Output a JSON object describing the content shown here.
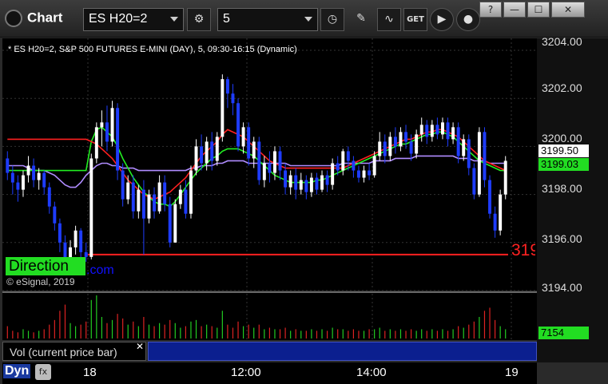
{
  "window": {
    "title": "Chart",
    "help_label": "?",
    "minimize_label": "—",
    "maximize_label": "☐",
    "close_label": "✕"
  },
  "toolbar": {
    "symbol": "ES H20=2",
    "interval": "5"
  },
  "chart": {
    "info_line": "* ES H20=2, S&P 500 FUTURES E-MINI (DAY), 5, 09:30-16:15 (Dynamic)",
    "copyright": "© eSignal, 2019",
    "direction_label": "Direction",
    "direction_link": ".com",
    "big_red_text": "319",
    "price_tags": {
      "last": "3199.50",
      "ma": "3199.03",
      "volume": "7154"
    },
    "y_ticks": [
      "3204.00",
      "3202.00",
      "3200.00",
      "3198.00",
      "3196.00",
      "3194.00"
    ],
    "x_ticks": [
      "18",
      "12:00",
      "14:00",
      "19"
    ],
    "colors": {
      "up": "#ffffff",
      "down": "#1e3cff",
      "ma_red": "#ff2020",
      "ma_green": "#22ee22",
      "ma_lavender": "#b08cff",
      "support": "#ff2020"
    }
  },
  "volume_panel": {
    "label": "Vol (current price bar)",
    "close_label": "✕"
  },
  "status": {
    "dyn_label": "Dyn",
    "fx_label": "fx"
  },
  "chart_data": {
    "type": "candlestick",
    "y_range": [
      3194,
      3204.5
    ],
    "support_level": 3195.5,
    "candles": [
      [
        3199.5,
        3198.9,
        3199.8,
        3198.6
      ],
      [
        3198.9,
        3198.5,
        3199.2,
        3198.0
      ],
      [
        3198.5,
        3198.2,
        3198.8,
        3197.7
      ],
      [
        3198.2,
        3198.8,
        3199.0,
        3197.9
      ],
      [
        3198.8,
        3199.2,
        3199.6,
        3198.5
      ],
      [
        3199.2,
        3198.6,
        3199.5,
        3198.3
      ],
      [
        3198.6,
        3198.9,
        3199.1,
        3198.2
      ],
      [
        3198.9,
        3198.3,
        3199.0,
        3198.0
      ],
      [
        3198.3,
        3197.5,
        3198.5,
        3197.2
      ],
      [
        3197.5,
        3196.8,
        3197.7,
        3196.5
      ],
      [
        3196.8,
        3196.0,
        3197.0,
        3195.6
      ],
      [
        3196.0,
        3195.3,
        3196.3,
        3195.0
      ],
      [
        3195.3,
        3195.8,
        3196.1,
        3195.0
      ],
      [
        3195.8,
        3196.5,
        3196.7,
        3195.5
      ],
      [
        3196.5,
        3195.6,
        3196.6,
        3195.3
      ],
      [
        3195.6,
        3195.4,
        3196.0,
        3195.2
      ],
      [
        3195.4,
        3199.5,
        3199.7,
        3195.3
      ],
      [
        3199.5,
        3200.8,
        3201.0,
        3199.3
      ],
      [
        3200.8,
        3201.0,
        3201.5,
        3200.0
      ],
      [
        3201.0,
        3200.2,
        3201.7,
        3199.8
      ],
      [
        3200.2,
        3201.6,
        3201.9,
        3200.0
      ],
      [
        3201.6,
        3199.0,
        3201.8,
        3198.6
      ],
      [
        3199.0,
        3197.8,
        3199.3,
        3197.5
      ],
      [
        3197.8,
        3198.5,
        3198.8,
        3197.6
      ],
      [
        3198.5,
        3197.3,
        3198.8,
        3197.0
      ],
      [
        3197.3,
        3198.2,
        3198.4,
        3197.0
      ],
      [
        3198.2,
        3197.0,
        3198.6,
        3195.5
      ],
      [
        3197.0,
        3198.0,
        3198.2,
        3196.8
      ],
      [
        3198.0,
        3197.3,
        3198.3,
        3197.0
      ],
      [
        3197.3,
        3198.5,
        3198.8,
        3197.2
      ],
      [
        3198.5,
        3197.6,
        3198.8,
        3197.3
      ],
      [
        3197.6,
        3196.0,
        3197.9,
        3195.8
      ],
      [
        3196.0,
        3197.6,
        3197.8,
        3196.0
      ],
      [
        3197.6,
        3198.2,
        3198.4,
        3197.4
      ],
      [
        3198.2,
        3197.2,
        3198.6,
        3197.0
      ],
      [
        3197.2,
        3199.0,
        3199.2,
        3197.0
      ],
      [
        3199.0,
        3200.0,
        3200.3,
        3198.8
      ],
      [
        3200.0,
        3199.3,
        3200.5,
        3199.0
      ],
      [
        3199.3,
        3200.2,
        3200.4,
        3199.0
      ],
      [
        3200.2,
        3199.4,
        3200.6,
        3199.0
      ],
      [
        3199.4,
        3200.4,
        3200.6,
        3199.2
      ],
      [
        3200.4,
        3202.8,
        3203.0,
        3200.2
      ],
      [
        3202.8,
        3202.2,
        3202.9,
        3201.6
      ],
      [
        3202.2,
        3201.8,
        3202.6,
        3201.3
      ],
      [
        3201.8,
        3200.0,
        3202.0,
        3199.8
      ],
      [
        3200.0,
        3200.8,
        3201.0,
        3199.7
      ],
      [
        3200.8,
        3199.5,
        3201.0,
        3199.2
      ],
      [
        3199.5,
        3200.2,
        3200.4,
        3199.1
      ],
      [
        3200.2,
        3198.6,
        3200.4,
        3198.4
      ],
      [
        3198.6,
        3199.3,
        3199.6,
        3198.3
      ],
      [
        3199.3,
        3198.9,
        3199.8,
        3198.5
      ],
      [
        3198.9,
        3199.8,
        3200.0,
        3198.6
      ],
      [
        3199.8,
        3199.0,
        3200.0,
        3198.6
      ],
      [
        3199.0,
        3198.3,
        3199.3,
        3198.0
      ],
      [
        3198.3,
        3198.8,
        3199.0,
        3198.0
      ],
      [
        3198.8,
        3198.2,
        3199.1,
        3197.8
      ],
      [
        3198.2,
        3198.6,
        3198.9,
        3198.0
      ],
      [
        3198.6,
        3198.1,
        3198.8,
        3197.8
      ],
      [
        3198.1,
        3198.7,
        3198.9,
        3197.9
      ],
      [
        3198.7,
        3198.2,
        3198.9,
        3198.0
      ],
      [
        3198.2,
        3198.8,
        3199.0,
        3198.1
      ],
      [
        3198.8,
        3198.4,
        3199.0,
        3198.1
      ],
      [
        3198.4,
        3199.3,
        3199.5,
        3198.2
      ],
      [
        3199.3,
        3199.0,
        3199.6,
        3198.8
      ],
      [
        3199.0,
        3199.8,
        3199.9,
        3198.8
      ],
      [
        3199.8,
        3199.4,
        3200.0,
        3199.0
      ],
      [
        3199.4,
        3199.0,
        3199.6,
        3198.7
      ],
      [
        3199.0,
        3198.7,
        3199.2,
        3198.5
      ],
      [
        3198.7,
        3199.0,
        3199.2,
        3198.5
      ],
      [
        3199.0,
        3198.8,
        3199.3,
        3198.6
      ],
      [
        3198.8,
        3199.6,
        3199.8,
        3198.7
      ],
      [
        3199.6,
        3200.2,
        3200.6,
        3199.4
      ],
      [
        3200.2,
        3199.6,
        3200.5,
        3199.3
      ],
      [
        3199.6,
        3200.4,
        3200.6,
        3199.4
      ],
      [
        3200.4,
        3200.0,
        3200.8,
        3199.7
      ],
      [
        3200.0,
        3200.6,
        3200.8,
        3199.8
      ],
      [
        3200.6,
        3200.2,
        3200.9,
        3199.9
      ],
      [
        3200.2,
        3199.7,
        3200.5,
        3199.4
      ],
      [
        3199.7,
        3200.5,
        3200.7,
        3199.5
      ],
      [
        3200.5,
        3200.9,
        3201.2,
        3200.2
      ],
      [
        3200.9,
        3200.4,
        3201.1,
        3200.1
      ],
      [
        3200.4,
        3200.9,
        3201.1,
        3200.2
      ],
      [
        3200.9,
        3200.5,
        3201.2,
        3200.3
      ],
      [
        3200.5,
        3201.0,
        3201.2,
        3200.3
      ],
      [
        3201.0,
        3200.3,
        3201.2,
        3200.0
      ],
      [
        3200.3,
        3200.8,
        3201.0,
        3200.1
      ],
      [
        3200.8,
        3199.6,
        3201.0,
        3199.3
      ],
      [
        3199.6,
        3200.3,
        3200.5,
        3199.4
      ],
      [
        3200.3,
        3199.1,
        3200.5,
        3198.8
      ],
      [
        3199.1,
        3198.0,
        3199.3,
        3197.8
      ],
      [
        3198.0,
        3200.6,
        3200.8,
        3197.9
      ],
      [
        3200.6,
        3198.6,
        3200.8,
        3198.3
      ],
      [
        3198.6,
        3197.2,
        3198.8,
        3197.0
      ],
      [
        3197.2,
        3196.5,
        3197.5,
        3196.2
      ],
      [
        3196.5,
        3198.0,
        3198.2,
        3196.3
      ],
      [
        3198.0,
        3199.4,
        3199.6,
        3197.8
      ]
    ],
    "volume": [
      8,
      5,
      4,
      6,
      5,
      4,
      5,
      6,
      9,
      12,
      18,
      22,
      10,
      8,
      9,
      11,
      25,
      28,
      14,
      10,
      12,
      16,
      13,
      9,
      11,
      8,
      14,
      9,
      8,
      10,
      9,
      12,
      10,
      7,
      8,
      11,
      12,
      8,
      9,
      8,
      7,
      18,
      9,
      7,
      11,
      8,
      9,
      7,
      9,
      6,
      7,
      6,
      6,
      7,
      5,
      6,
      5,
      5,
      6,
      5,
      6,
      5,
      7,
      6,
      6,
      5,
      6,
      5,
      5,
      6,
      6,
      7,
      5,
      6,
      5,
      6,
      5,
      6,
      5,
      6,
      5,
      6,
      5,
      6,
      5,
      6,
      8,
      7,
      9,
      11,
      14,
      18,
      20,
      12,
      8,
      6
    ],
    "ma_red": [
      3200.3,
      3200.3,
      3200.3,
      3200.3,
      3200.3,
      3200.3,
      3200.3,
      3200.3,
      3200.3,
      3200.3,
      3200.3,
      3200.3,
      3200.3,
      3200.3,
      3200.3,
      3200.3,
      3200.2,
      3200.1,
      3199.9,
      3199.7,
      3199.5,
      3199.2,
      3198.9,
      3198.6,
      3198.4,
      3198.2,
      3198.0,
      3197.9,
      3197.8,
      3197.9,
      3198.0,
      3198.1,
      3198.3,
      3198.5,
      3198.7,
      3199.0,
      3199.3,
      3199.6,
      3199.8,
      3200.0,
      3200.2,
      3200.5,
      3200.7,
      3200.6,
      3200.5,
      3200.4,
      3200.2,
      3200.0,
      3199.8,
      3199.6,
      3199.4,
      3199.3,
      3199.2,
      3199.1,
      3199.1,
      3199.1,
      3199.1,
      3199.1,
      3199.1,
      3199.1,
      3199.1,
      3199.1,
      3199.1,
      3199.1,
      3199.1,
      3199.2,
      3199.3,
      3199.4,
      3199.5,
      3199.6,
      3199.7,
      3199.8,
      3199.9,
      3200.0,
      3200.1,
      3200.2,
      3200.3,
      3200.3,
      3200.4,
      3200.5,
      3200.6,
      3200.6,
      3200.7,
      3200.7,
      3200.6,
      3200.5,
      3200.4,
      3200.2,
      3200.0,
      3199.8,
      3199.6,
      3199.4,
      3199.3,
      3199.2,
      3199.1,
      3199.0
    ],
    "ma_green": [
      3199.0,
      3199.0,
      3199.0,
      3199.0,
      3199.0,
      3199.0,
      3199.0,
      3199.0,
      3199.0,
      3199.0,
      3199.0,
      3199.0,
      3199.0,
      3199.0,
      3199.0,
      3199.0,
      3200.2,
      3200.7,
      3200.8,
      3200.6,
      3200.4,
      3200.0,
      3199.5,
      3199.1,
      3198.7,
      3198.4,
      3198.1,
      3197.9,
      3197.7,
      3197.6,
      3197.6,
      3197.5,
      3197.7,
      3198.0,
      3198.3,
      3198.6,
      3198.9,
      3199.1,
      3199.3,
      3199.5,
      3199.6,
      3199.8,
      3199.9,
      3199.9,
      3199.9,
      3199.8,
      3199.7,
      3199.6,
      3199.4,
      3199.2,
      3199.0,
      3198.8,
      3198.7,
      3198.6,
      3198.5,
      3198.5,
      3198.5,
      3198.5,
      3198.5,
      3198.6,
      3198.6,
      3198.7,
      3198.8,
      3198.9,
      3199.0,
      3199.1,
      3199.2,
      3199.3,
      3199.4,
      3199.5,
      3199.6,
      3199.7,
      3199.8,
      3199.9,
      3200.0,
      3200.1,
      3200.1,
      3200.2,
      3200.3,
      3200.4,
      3200.5,
      3200.5,
      3200.6,
      3200.6,
      3200.5,
      3200.4,
      3200.2,
      3200.0,
      3199.8,
      3199.6,
      3199.4,
      3199.3,
      3199.2,
      3199.1,
      3199.0,
      3199.0
    ],
    "ma_lavender": [
      3199.2,
      3199.2,
      3199.2,
      3199.2,
      3199.1,
      3199.0,
      3199.0,
      3199.0,
      3198.9,
      3198.8,
      3198.6,
      3198.4,
      3198.3,
      3198.3,
      3198.5,
      3198.8,
      3199.0,
      3199.2,
      3199.3,
      3199.3,
      3199.2,
      3199.2,
      3199.1,
      3199.1,
      3199.1,
      3199.0,
      3199.0,
      3199.0,
      3199.0,
      3199.0,
      3199.0,
      3199.0,
      3199.0,
      3199.0,
      3199.0,
      3199.1,
      3199.1,
      3199.2,
      3199.2,
      3199.2,
      3199.3,
      3199.3,
      3199.4,
      3199.4,
      3199.4,
      3199.4,
      3199.3,
      3199.3,
      3199.3,
      3199.3,
      3199.3,
      3199.3,
      3199.3,
      3199.3,
      3199.2,
      3199.2,
      3199.2,
      3199.2,
      3199.2,
      3199.2,
      3199.2,
      3199.2,
      3199.2,
      3199.2,
      3199.3,
      3199.3,
      3199.3,
      3199.3,
      3199.3,
      3199.3,
      3199.4,
      3199.4,
      3199.4,
      3199.4,
      3199.5,
      3199.5,
      3199.5,
      3199.5,
      3199.6,
      3199.6,
      3199.6,
      3199.6,
      3199.6,
      3199.6,
      3199.6,
      3199.6,
      3199.5,
      3199.5,
      3199.5,
      3199.4,
      3199.4,
      3199.4,
      3199.3,
      3199.3,
      3199.3,
      3199.3
    ]
  }
}
